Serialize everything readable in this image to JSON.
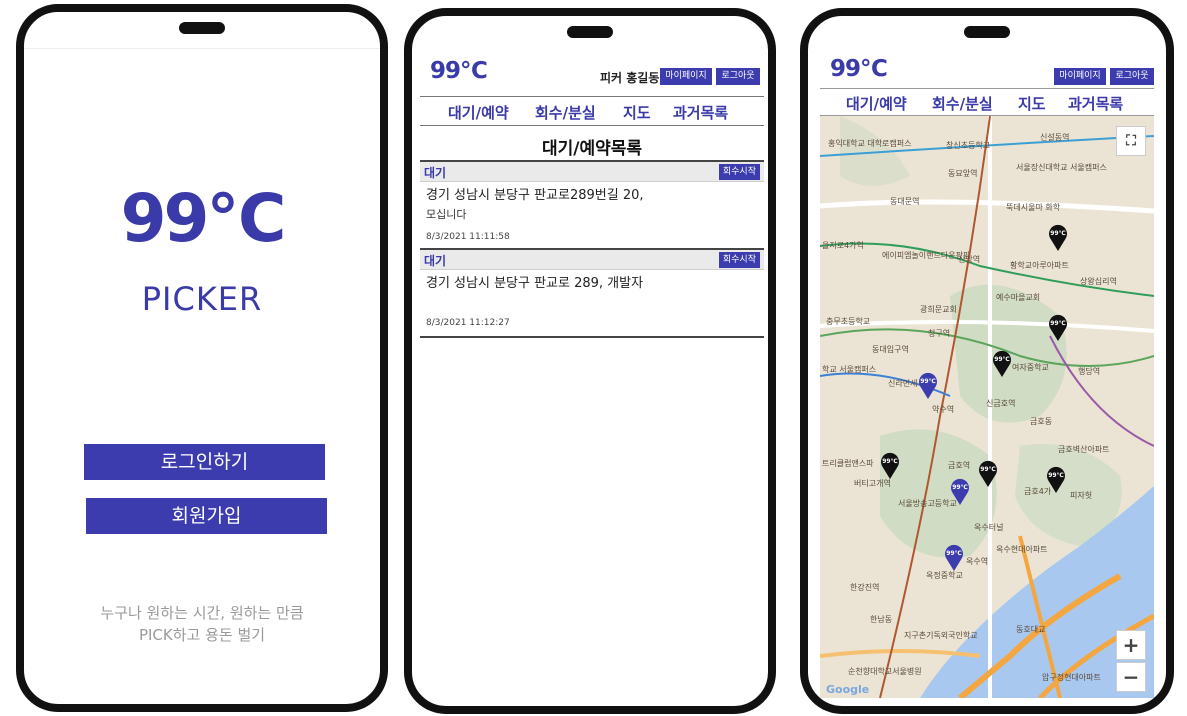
{
  "splash": {
    "logo": "99℃",
    "subtitle": "PICKER",
    "login_label": "로그인하기",
    "signup_label": "회원가입",
    "tagline_line1": "누구나 원하는 시간, 원하는 만큼",
    "tagline_line2": "PICK하고 용돈 벌기"
  },
  "header": {
    "brand": "99℃",
    "user_name": "피커 홍길동",
    "mypage_label": "마이페이지",
    "logout_label": "로그아웃"
  },
  "nav": {
    "items": [
      {
        "label": "대기/예약"
      },
      {
        "label": "회수/분실"
      },
      {
        "label": "지도"
      },
      {
        "label": "과거목록"
      }
    ]
  },
  "list": {
    "title": "대기/예약목록",
    "cards": [
      {
        "status": "대기",
        "action": "회수시작",
        "address": "경기 성남시 분당구 판교로289번길 20,",
        "note": "모십니다",
        "time": "8/3/2021 11:11:58"
      },
      {
        "status": "대기",
        "action": "회수시작",
        "address": "경기 성남시 분당구 판교로 289, 개발자",
        "note": "",
        "time": "8/3/2021 11:12:27"
      }
    ]
  },
  "map": {
    "pin_label": "99℃",
    "zoom_in": "+",
    "zoom_out": "−",
    "fullscreen_icon": "fullscreen-icon",
    "google_mark": "Google",
    "colors": {
      "brand": "#3c3caf",
      "water": "#a8c8f0",
      "road": "#f4a640",
      "land": "#e9e2d2"
    },
    "labels": [
      "홍익대학교 대학로캠퍼스",
      "창신초등학교",
      "신설동역",
      "동묘앞역",
      "서울장신대학교 서울캠퍼스",
      "동대문역",
      "뚝데시울마 화학",
      "을지로4가역",
      "에이피엠놀이랜드다운팡팡",
      "신당역",
      "황학교아루아파트",
      "상왕십리역",
      "광희문교회",
      "예수마을교회",
      "충무초등학교",
      "청구역",
      "동대입구역",
      "학교 서울캠퍼스",
      "신라면세",
      "여자중학교",
      "행당역",
      "약수역",
      "신금호역",
      "금호동",
      "금호벽산아파트",
      "트리클럽앤스파",
      "버티고개역",
      "금호역",
      "서울방송고등학교",
      "금호4가",
      "피자헛",
      "옥수터널",
      "옥수현대아파트",
      "옥수역",
      "옥정중학교",
      "한강진역",
      "한남동",
      "지구촌기독외국인학교",
      "동호대교",
      "순천향대학교서울병원",
      "압구정현대아파트"
    ]
  }
}
